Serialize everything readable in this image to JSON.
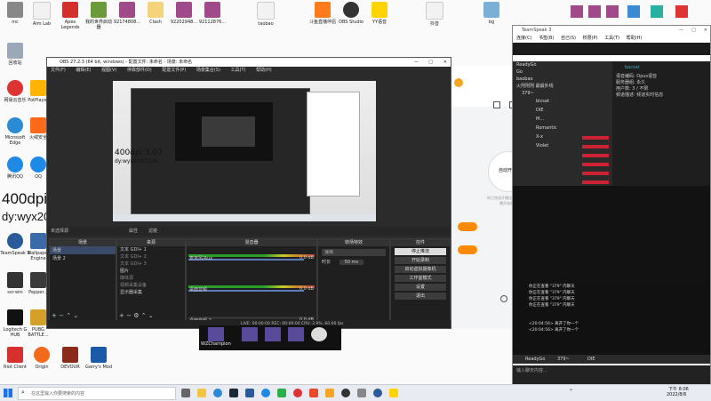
{
  "desktop": {
    "icons_top": [
      {
        "label": "mc",
        "color": "#888888"
      },
      {
        "label": "Aim Lab",
        "color": "#f2f2f2"
      },
      {
        "label": "Apex Legends",
        "color": "#d32f2f"
      },
      {
        "label": "我的世界启动器",
        "color": "#6a9a3a"
      },
      {
        "label": "92174808...",
        "color": "#a14a8a"
      },
      {
        "label": "Clash",
        "color": "#f4d37a"
      },
      {
        "label": "92202948...",
        "color": "#a14a8a"
      },
      {
        "label": "92112876...",
        "color": "#a14a8a"
      },
      {
        "label": "taobao",
        "color": "#f2f2f2"
      },
      {
        "label": "斗鱼直播伴侣",
        "color": "#ff7a1a"
      },
      {
        "label": "OBS Studio",
        "color": "#333333"
      },
      {
        "label": "YY语音",
        "color": "#ffd400"
      },
      {
        "label": "抖音",
        "color": "#f2f2f2"
      },
      {
        "label": "bg",
        "color": "#7ab0d8"
      }
    ],
    "icons_left": [
      {
        "label": "回收站",
        "color": "#9aa8b8"
      },
      {
        "label": "网易云音乐",
        "color": "#d33"
      },
      {
        "label": "Microsoft Edge",
        "color": "#2a8ad4"
      },
      {
        "label": "腾讯QQ",
        "color": "#1e8ae6"
      },
      {
        "label": "TeamSpeak 3",
        "color": "#2a5a9a"
      },
      {
        "label": "ssr-win",
        "color": "#333"
      },
      {
        "label": "Logitech G HUB",
        "color": "#111"
      },
      {
        "label": "Riot Client",
        "color": "#d62f2f"
      }
    ],
    "icons_left2": [
      {
        "label": "PotPlayer",
        "color": "#ffb400"
      },
      {
        "label": "火绒安全",
        "color": "#ff6a1a"
      },
      {
        "label": "QQ",
        "color": "#1e8ae6"
      },
      {
        "label": "Wallpaper Engine",
        "color": "#3a6aa8"
      },
      {
        "label": "Pepper...",
        "color": "#3a3a3a"
      },
      {
        "label": "PUBG BATTLE...",
        "color": "#d4a02a"
      }
    ],
    "icons_bottom": [
      {
        "label": "Origin",
        "color": "#f26a1a"
      },
      {
        "label": "DEVOUR",
        "color": "#8a2a1a"
      },
      {
        "label": "Garry's Mod",
        "color": "#1a5aaa"
      }
    ],
    "overlay_line1": "400dpi 3.07",
    "overlay_line2": "dy:wyx2007116."
  },
  "obs": {
    "title": "OBS 27.2.3 (64 bit, windows) - 配置文件: 未命名 - 场景: 未命名",
    "menu": [
      "文件(F)",
      "编辑(E)",
      "视图(V)",
      "停靠部件(D)",
      "配置文件(P)",
      "场景集合(S)",
      "工具(T)",
      "帮助(H)"
    ],
    "preview_overlay1": "400dpi 3.07",
    "preview_overlay2": "dy:wyx2007116.",
    "source_label1": "未选择源",
    "prop_button": "属性",
    "filter_button": "滤镜",
    "scenes_header": "场景",
    "scenes": [
      "场景",
      "场景 2"
    ],
    "sources_header": "来源",
    "sources": [
      "文本 GDI+ 1",
      "文本 GDI+ 2",
      "文本 GDI+ 3",
      "图片",
      "媒体源",
      "视频采集设备",
      "显示器采集"
    ],
    "mixer_header": "混音器",
    "mixer_channels": [
      {
        "name": "麦克风/Aux",
        "value": "0.0 dB"
      },
      {
        "name": "桌面音频",
        "value": "0.0 dB"
      },
      {
        "name": "桌面音频 2",
        "value": "0.0 dB"
      }
    ],
    "transition_header": "转场特效",
    "transition_value": "淡出",
    "duration_label": "时长",
    "duration_value": "50 ms",
    "controls_header": "控件",
    "controls": [
      "停止推流",
      "开始录制",
      "启动虚拟摄像机",
      "工作室模式",
      "设置",
      "退出"
    ],
    "status": "LIVE: 00:00:00   REC: 00:00:00   CPU: 3.9%, 60.00 fps"
  },
  "stream_app": {
    "header_label": "主播",
    "start_button": "自动开播",
    "side_button": "退出",
    "hint": "你已完成开播设置，点击开播开始直播"
  },
  "yy": {
    "title": "TeamSpeak 3",
    "menu": [
      "连接(C)",
      "书签(B)",
      "自己(S)",
      "权限(P)",
      "工具(T)",
      "帮助(H)"
    ],
    "tree": [
      {
        "name": "ReadyGo",
        "depth": 0
      },
      {
        "name": "Go",
        "depth": 1
      },
      {
        "name": "baobao",
        "depth": 1
      },
      {
        "name": "火刑刑刑 最最外线",
        "depth": 1
      },
      {
        "name": "379~",
        "depth": 1
      },
      {
        "name": "bicsat",
        "depth": 2
      },
      {
        "name": "DIE",
        "depth": 2
      },
      {
        "name": "M...",
        "depth": 2
      },
      {
        "name": "Romantic",
        "depth": 2
      },
      {
        "name": "X-x",
        "depth": 2
      },
      {
        "name": "Violet",
        "depth": 2
      }
    ],
    "info_name": "bacsat",
    "info_rows": [
      {
        "k": "语音编码:",
        "v": "Opus语音"
      },
      {
        "k": "服务器组:",
        "v": "永久"
      },
      {
        "k": "用户数:",
        "v": "3 / 不限"
      },
      {
        "k": "频道描述:",
        "v": "频道实时信息"
      }
    ],
    "log": [
      "你正在查看 \"379\" 内聊天",
      "你正在查看 \"379\" 内聊天",
      "你正在查看 \"379\" 内聊天",
      "你正在查看 \"379\" 内聊天",
      "<20:04:56> 离开了你一个",
      "<20:04:56> 离开了你一个"
    ],
    "tabs": [
      "ReadyGo",
      "379~",
      "DIE"
    ],
    "input_placeholder": "输入聊天内容..."
  },
  "bottom_strip": {
    "items": [
      "WZChampion"
    ]
  },
  "taskbar": {
    "search_placeholder": "在这里输入你要搜索的内容",
    "time": "下午 8:06",
    "date": "2022/8/6"
  }
}
